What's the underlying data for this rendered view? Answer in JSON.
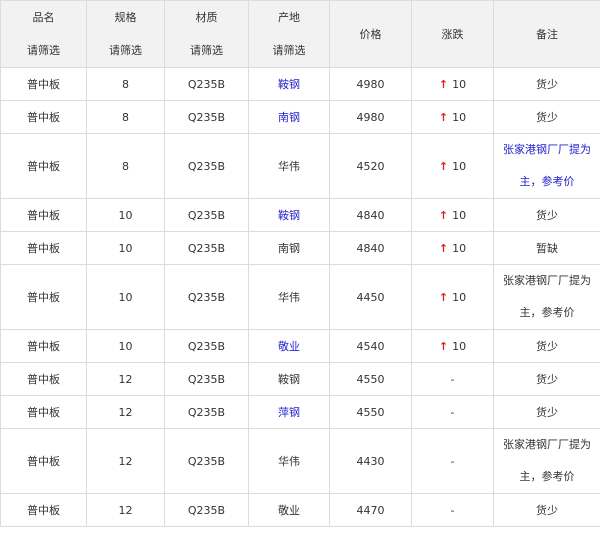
{
  "headers": {
    "name": {
      "label": "品名",
      "filter": "请筛选"
    },
    "spec": {
      "label": "规格",
      "filter": "请筛选"
    },
    "material": {
      "label": "材质",
      "filter": "请筛选"
    },
    "origin": {
      "label": "产地",
      "filter": "请筛选"
    },
    "price": {
      "label": "价格"
    },
    "change": {
      "label": "涨跌"
    },
    "remark": {
      "label": "备注"
    }
  },
  "rows": [
    {
      "name": "普中板",
      "spec": "8",
      "material": "Q235B",
      "origin": "鞍钢",
      "origin_link": true,
      "price": "4980",
      "arrow": "↑",
      "change": "10",
      "remark": "货少",
      "remark_link": false
    },
    {
      "name": "普中板",
      "spec": "8",
      "material": "Q235B",
      "origin": "南钢",
      "origin_link": true,
      "price": "4980",
      "arrow": "↑",
      "change": "10",
      "remark": "货少",
      "remark_link": false
    },
    {
      "name": "普中板",
      "spec": "8",
      "material": "Q235B",
      "origin": "华伟",
      "origin_link": false,
      "price": "4520",
      "arrow": "↑",
      "change": "10",
      "remark": "张家港钢厂厂提为主，参考价",
      "remark_link": true,
      "tall": true
    },
    {
      "name": "普中板",
      "spec": "10",
      "material": "Q235B",
      "origin": "鞍钢",
      "origin_link": true,
      "price": "4840",
      "arrow": "↑",
      "change": "10",
      "remark": "货少",
      "remark_link": false
    },
    {
      "name": "普中板",
      "spec": "10",
      "material": "Q235B",
      "origin": "南钢",
      "origin_link": false,
      "price": "4840",
      "arrow": "↑",
      "change": "10",
      "remark": "暂缺",
      "remark_link": false
    },
    {
      "name": "普中板",
      "spec": "10",
      "material": "Q235B",
      "origin": "华伟",
      "origin_link": false,
      "price": "4450",
      "arrow": "↑",
      "change": "10",
      "remark": "张家港钢厂厂提为主，参考价",
      "remark_link": false,
      "tall": true
    },
    {
      "name": "普中板",
      "spec": "10",
      "material": "Q235B",
      "origin": "敬业",
      "origin_link": true,
      "price": "4540",
      "arrow": "↑",
      "change": "10",
      "remark": "货少",
      "remark_link": false
    },
    {
      "name": "普中板",
      "spec": "12",
      "material": "Q235B",
      "origin": "鞍钢",
      "origin_link": false,
      "price": "4550",
      "arrow": "",
      "change": "-",
      "remark": "货少",
      "remark_link": false
    },
    {
      "name": "普中板",
      "spec": "12",
      "material": "Q235B",
      "origin": "萍钢",
      "origin_link": true,
      "price": "4550",
      "arrow": "",
      "change": "-",
      "remark": "货少",
      "remark_link": false
    },
    {
      "name": "普中板",
      "spec": "12",
      "material": "Q235B",
      "origin": "华伟",
      "origin_link": false,
      "price": "4430",
      "arrow": "",
      "change": "-",
      "remark": "张家港钢厂厂提为主，参考价",
      "remark_link": false,
      "tall": true
    },
    {
      "name": "普中板",
      "spec": "12",
      "material": "Q235B",
      "origin": "敬业",
      "origin_link": false,
      "price": "4470",
      "arrow": "",
      "change": "-",
      "remark": "货少",
      "remark_link": false
    }
  ],
  "colors": {
    "link": "#2222cc",
    "up_arrow": "#e02020",
    "header_bg": "#f2f2f2",
    "border": "#dcdcdc"
  }
}
